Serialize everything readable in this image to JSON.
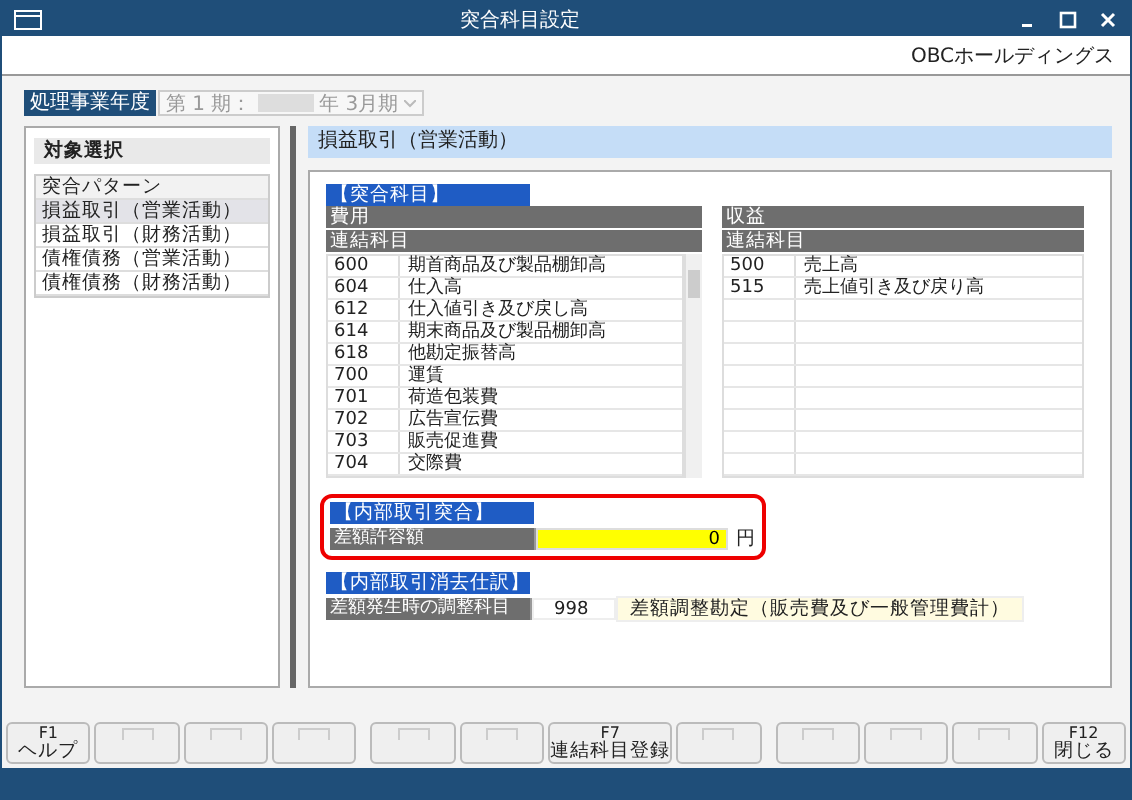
{
  "window": {
    "title": "突合科目設定"
  },
  "company": "OBCホールディングス",
  "fiscal": {
    "label": "処理事業年度",
    "period": "第 1 期：",
    "year_unit": "年",
    "month": "3月期",
    "disabled": true
  },
  "target": {
    "title": "対象選択",
    "header": "突合パターン",
    "items": [
      {
        "label": "損益取引（営業活動）",
        "selected": true
      },
      {
        "label": "損益取引（財務活動）",
        "selected": false
      },
      {
        "label": "債権債務（営業活動）",
        "selected": false
      },
      {
        "label": "債権債務（財務活動）",
        "selected": false
      }
    ]
  },
  "detail": {
    "title": "損益取引（営業活動）",
    "match_section": {
      "title": "【突合科目】",
      "expense": {
        "title": "費用",
        "column": "連結科目",
        "rows": [
          {
            "code": "600",
            "name": "期首商品及び製品棚卸高"
          },
          {
            "code": "604",
            "name": "仕入高"
          },
          {
            "code": "612",
            "name": "仕入値引き及び戻し高"
          },
          {
            "code": "614",
            "name": "期末商品及び製品棚卸高"
          },
          {
            "code": "618",
            "name": "他勘定振替高"
          },
          {
            "code": "700",
            "name": "運賃"
          },
          {
            "code": "701",
            "name": "荷造包装費"
          },
          {
            "code": "702",
            "name": "広告宣伝費"
          },
          {
            "code": "703",
            "name": "販売促進費"
          },
          {
            "code": "704",
            "name": "交際費"
          }
        ]
      },
      "revenue": {
        "title": "収益",
        "column": "連結科目",
        "rows": [
          {
            "code": "500",
            "name": "売上高"
          },
          {
            "code": "515",
            "name": "売上値引き及び戻り高"
          }
        ]
      }
    },
    "tolerance_section": {
      "title": "【内部取引突合】",
      "highlighted": true,
      "label": "差額許容額",
      "value": "0",
      "unit": "円"
    },
    "elimination_section": {
      "title": "【内部取引消去仕訳】",
      "label": "差額発生時の調整科目",
      "code": "998",
      "name": "差額調整勘定（販売費及び一般管理費計）"
    }
  },
  "function_keys": [
    {
      "kind": "labeled",
      "key": "F1",
      "label": "ヘルプ"
    },
    {
      "kind": "empty"
    },
    {
      "kind": "empty"
    },
    {
      "kind": "empty"
    },
    {
      "kind": "empty"
    },
    {
      "kind": "empty"
    },
    {
      "kind": "labeled",
      "key": "F7",
      "label": "連結科目登録"
    },
    {
      "kind": "empty"
    },
    {
      "kind": "empty"
    },
    {
      "kind": "empty"
    },
    {
      "kind": "empty"
    },
    {
      "kind": "labeled",
      "key": "F12",
      "label": "閉じる"
    }
  ]
}
